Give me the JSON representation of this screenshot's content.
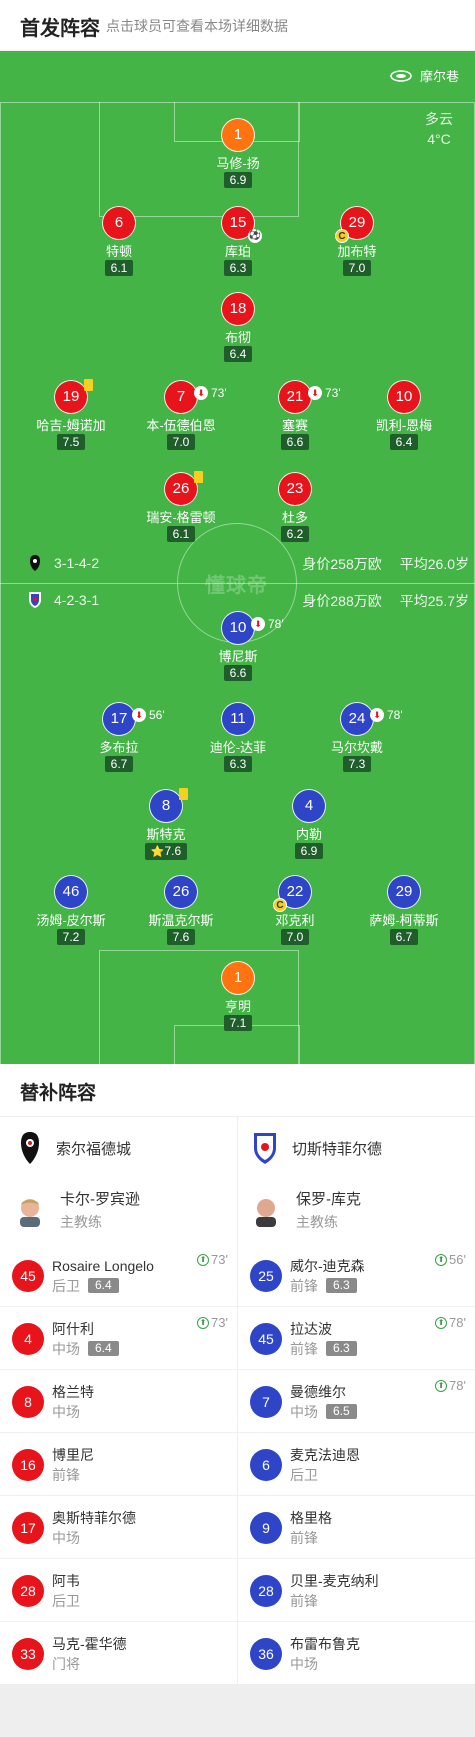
{
  "header": {
    "title": "首发阵容",
    "subtitle": "点击球员可查看本场详细数据"
  },
  "venue": {
    "name": "摩尔巷"
  },
  "weather": {
    "condition": "多云",
    "temperature": "4°C"
  },
  "watermark": "懂球帝",
  "home": {
    "formation": "3-1-4-2",
    "value": "身价258万欧",
    "age": "平均26.0岁",
    "players": [
      {
        "num": "1",
        "name": "马修-扬",
        "rating": "6.9",
        "color": "gk"
      },
      {
        "num": "6",
        "name": "特顿",
        "rating": "6.1",
        "color": "red"
      },
      {
        "num": "15",
        "name": "库珀",
        "rating": "6.3",
        "color": "red",
        "goal": true
      },
      {
        "num": "29",
        "name": "加布特",
        "rating": "7.0",
        "color": "red",
        "captain": true
      },
      {
        "num": "18",
        "name": "布彻",
        "rating": "6.4",
        "color": "red"
      },
      {
        "num": "19",
        "name": "哈吉-姆诺加",
        "rating": "7.5",
        "color": "red",
        "yellow": true
      },
      {
        "num": "7",
        "name": "本-伍德伯恩",
        "rating": "7.0",
        "color": "red",
        "sub_off": "73'"
      },
      {
        "num": "21",
        "name": "塞赛",
        "rating": "6.6",
        "color": "red",
        "sub_off": "73'"
      },
      {
        "num": "10",
        "name": "凯利-恩梅",
        "rating": "6.4",
        "color": "red"
      },
      {
        "num": "26",
        "name": "瑞安-格雷顿",
        "rating": "6.1",
        "color": "red",
        "yellow": true
      },
      {
        "num": "23",
        "name": "杜多",
        "rating": "6.2",
        "color": "red"
      }
    ]
  },
  "away": {
    "formation": "4-2-3-1",
    "value": "身价288万欧",
    "age": "平均25.7岁",
    "players": [
      {
        "num": "10",
        "name": "博尼斯",
        "rating": "6.6",
        "color": "blue",
        "sub_off": "78'"
      },
      {
        "num": "17",
        "name": "多布拉",
        "rating": "6.7",
        "color": "blue",
        "sub_off": "56'"
      },
      {
        "num": "11",
        "name": "迪伦-达菲",
        "rating": "6.3",
        "color": "blue"
      },
      {
        "num": "24",
        "name": "马尔坎戴",
        "rating": "7.3",
        "color": "blue",
        "sub_off": "78'"
      },
      {
        "num": "8",
        "name": "斯特克",
        "rating": "7.6",
        "color": "blue",
        "yellow": true,
        "star": true
      },
      {
        "num": "4",
        "name": "内勒",
        "rating": "6.9",
        "color": "blue"
      },
      {
        "num": "46",
        "name": "汤姆-皮尔斯",
        "rating": "7.2",
        "color": "blue"
      },
      {
        "num": "26",
        "name": "斯温克尔斯",
        "rating": "7.6",
        "color": "blue"
      },
      {
        "num": "22",
        "name": "邓克利",
        "rating": "7.0",
        "color": "blue",
        "captain": true
      },
      {
        "num": "29",
        "name": "萨姆-柯蒂斯",
        "rating": "6.7",
        "color": "blue"
      },
      {
        "num": "1",
        "name": "亨明",
        "rating": "7.1",
        "color": "gk"
      }
    ]
  },
  "subs": {
    "title": "替补阵容",
    "home_team": "索尔福德城",
    "away_team": "切斯特菲尔德",
    "home_coach": {
      "name": "卡尔-罗宾逊",
      "role": "主教练"
    },
    "away_coach": {
      "name": "保罗-库克",
      "role": "主教练"
    },
    "home": [
      {
        "num": "45",
        "name": "Rosaire Longelo",
        "pos": "后卫",
        "rating": "6.4",
        "in": "73'"
      },
      {
        "num": "4",
        "name": "阿什利",
        "pos": "中场",
        "rating": "6.4",
        "in": "73'"
      },
      {
        "num": "8",
        "name": "格兰特",
        "pos": "中场"
      },
      {
        "num": "16",
        "name": "博里尼",
        "pos": "前锋"
      },
      {
        "num": "17",
        "name": "奥斯特菲尔德",
        "pos": "中场"
      },
      {
        "num": "28",
        "name": "阿韦",
        "pos": "后卫"
      },
      {
        "num": "33",
        "name": "马克-霍华德",
        "pos": "门将"
      }
    ],
    "away": [
      {
        "num": "25",
        "name": "威尔-迪克森",
        "pos": "前锋",
        "rating": "6.3",
        "in": "56'"
      },
      {
        "num": "45",
        "name": "拉达波",
        "pos": "前锋",
        "rating": "6.3",
        "in": "78'"
      },
      {
        "num": "7",
        "name": "曼德维尔",
        "pos": "中场",
        "rating": "6.5",
        "in": "78'"
      },
      {
        "num": "6",
        "name": "麦克法迪恩",
        "pos": "后卫"
      },
      {
        "num": "9",
        "name": "格里格",
        "pos": "前锋"
      },
      {
        "num": "28",
        "name": "贝里-麦克纳利",
        "pos": "前锋"
      },
      {
        "num": "36",
        "name": "布雷布鲁克",
        "pos": "中场"
      }
    ]
  }
}
